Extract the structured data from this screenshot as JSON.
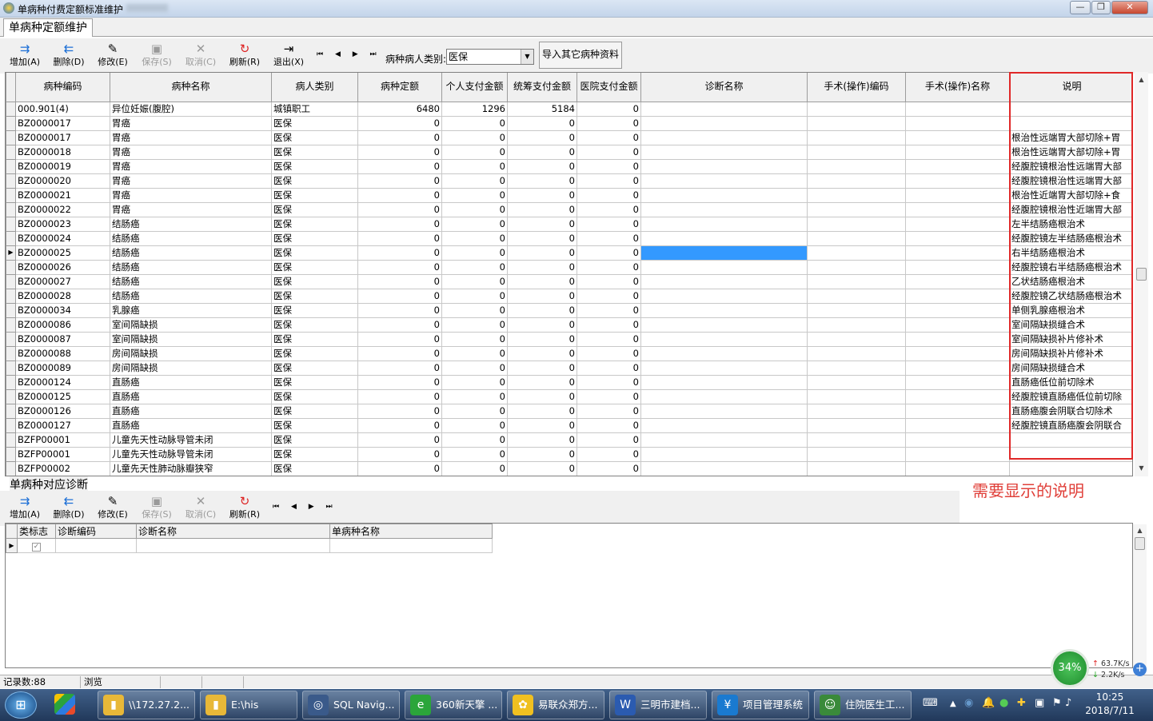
{
  "window": {
    "title": "单病种付费定额标准维护"
  },
  "tab": {
    "label": "单病种定额维护"
  },
  "toolbar": {
    "add": "增加(A)",
    "delete": "删除(D)",
    "edit": "修改(E)",
    "save": "保存(S)",
    "cancel": "取消(C)",
    "refresh": "刷新(R)",
    "exit": "退出(X)",
    "nav": "⏮ ◀ ▶ ⏭",
    "type_label": "病种病人类别:",
    "type_value": "医保",
    "import": "导入其它病种资料"
  },
  "grid": {
    "headers": [
      "病种编码",
      "病种名称",
      "病人类别",
      "病种定额",
      "个人支付金额",
      "统筹支付金额",
      "医院支付金额",
      "诊断名称",
      "手术(操作)编码",
      "手术(操作)名称",
      "说明"
    ],
    "rows": [
      [
        "000.901(4)",
        "异位妊娠(腹腔)",
        "城镇职工",
        "6480",
        "1296",
        "5184",
        "0",
        "",
        "",
        "",
        ""
      ],
      [
        "BZ0000017",
        "胃癌",
        "医保",
        "0",
        "0",
        "0",
        "0",
        "",
        "",
        "",
        ""
      ],
      [
        "BZ0000017",
        "胃癌",
        "医保",
        "0",
        "0",
        "0",
        "0",
        "",
        "",
        "",
        "根治性远端胃大部切除+胃"
      ],
      [
        "BZ0000018",
        "胃癌",
        "医保",
        "0",
        "0",
        "0",
        "0",
        "",
        "",
        "",
        "根治性远端胃大部切除+胃"
      ],
      [
        "BZ0000019",
        "胃癌",
        "医保",
        "0",
        "0",
        "0",
        "0",
        "",
        "",
        "",
        "经腹腔镜根治性远端胃大部"
      ],
      [
        "BZ0000020",
        "胃癌",
        "医保",
        "0",
        "0",
        "0",
        "0",
        "",
        "",
        "",
        "经腹腔镜根治性远端胃大部"
      ],
      [
        "BZ0000021",
        "胃癌",
        "医保",
        "0",
        "0",
        "0",
        "0",
        "",
        "",
        "",
        "根治性近端胃大部切除+食"
      ],
      [
        "BZ0000022",
        "胃癌",
        "医保",
        "0",
        "0",
        "0",
        "0",
        "",
        "",
        "",
        "经腹腔镜根治性近端胃大部"
      ],
      [
        "BZ0000023",
        "结肠癌",
        "医保",
        "0",
        "0",
        "0",
        "0",
        "",
        "",
        "",
        "左半结肠癌根治术"
      ],
      [
        "BZ0000024",
        "结肠癌",
        "医保",
        "0",
        "0",
        "0",
        "0",
        "",
        "",
        "",
        "经腹腔镜左半结肠癌根治术"
      ],
      [
        "BZ0000025",
        "结肠癌",
        "医保",
        "0",
        "0",
        "0",
        "0",
        "",
        "",
        "",
        "右半结肠癌根治术"
      ],
      [
        "BZ0000026",
        "结肠癌",
        "医保",
        "0",
        "0",
        "0",
        "0",
        "",
        "",
        "",
        "经腹腔镜右半结肠癌根治术"
      ],
      [
        "BZ0000027",
        "结肠癌",
        "医保",
        "0",
        "0",
        "0",
        "0",
        "",
        "",
        "",
        "乙状结肠癌根治术"
      ],
      [
        "BZ0000028",
        "结肠癌",
        "医保",
        "0",
        "0",
        "0",
        "0",
        "",
        "",
        "",
        "经腹腔镜乙状结肠癌根治术"
      ],
      [
        "BZ0000034",
        "乳腺癌",
        "医保",
        "0",
        "0",
        "0",
        "0",
        "",
        "",
        "",
        "单侧乳腺癌根治术"
      ],
      [
        "BZ0000086",
        "室间隔缺损",
        "医保",
        "0",
        "0",
        "0",
        "0",
        "",
        "",
        "",
        "室间隔缺损缝合术"
      ],
      [
        "BZ0000087",
        "室间隔缺损",
        "医保",
        "0",
        "0",
        "0",
        "0",
        "",
        "",
        "",
        "室间隔缺损补片修补术"
      ],
      [
        "BZ0000088",
        "房间隔缺损",
        "医保",
        "0",
        "0",
        "0",
        "0",
        "",
        "",
        "",
        "房间隔缺损补片修补术"
      ],
      [
        "BZ0000089",
        "房间隔缺损",
        "医保",
        "0",
        "0",
        "0",
        "0",
        "",
        "",
        "",
        "房间隔缺损缝合术"
      ],
      [
        "BZ0000124",
        "直肠癌",
        "医保",
        "0",
        "0",
        "0",
        "0",
        "",
        "",
        "",
        "直肠癌低位前切除术"
      ],
      [
        "BZ0000125",
        "直肠癌",
        "医保",
        "0",
        "0",
        "0",
        "0",
        "",
        "",
        "",
        "经腹腔镜直肠癌低位前切除"
      ],
      [
        "BZ0000126",
        "直肠癌",
        "医保",
        "0",
        "0",
        "0",
        "0",
        "",
        "",
        "",
        "直肠癌腹会阴联合切除术"
      ],
      [
        "BZ0000127",
        "直肠癌",
        "医保",
        "0",
        "0",
        "0",
        "0",
        "",
        "",
        "",
        "经腹腔镜直肠癌腹会阴联合"
      ],
      [
        "BZFP00001",
        "儿童先天性动脉导管未闭",
        "医保",
        "0",
        "0",
        "0",
        "0",
        "",
        "",
        "",
        ""
      ],
      [
        "BZFP00001",
        "儿童先天性动脉导管未闭",
        "医保",
        "0",
        "0",
        "0",
        "0",
        "",
        "",
        "",
        ""
      ],
      [
        "BZFP00002",
        "儿童先天性肺动脉瓣狭窄",
        "医保",
        "0",
        "0",
        "0",
        "0",
        "",
        "",
        "",
        ""
      ]
    ],
    "current_row": 10
  },
  "annotation": "需要显示的说明",
  "section2": {
    "title": "单病种对应诊断",
    "headers": [
      "类标志",
      "诊断编码",
      "诊断名称",
      "单病种名称"
    ]
  },
  "status": {
    "record_count": "记录数:88",
    "mode": "浏览"
  },
  "net": {
    "percent": "34%",
    "up": "63.7K/s",
    "down": "2.2K/s"
  },
  "taskbar": {
    "items": [
      "\\\\172.27.2...",
      "E:\\his",
      "SQL Navig...",
      "360新天擎 ...",
      "易联众郑方...",
      "三明市建档...",
      "项目管理系统",
      "住院医生工..."
    ]
  },
  "clock": {
    "time": "10:25",
    "date": "2018/7/11"
  },
  "colors": {
    "highlight": "#e02828",
    "selection": "#3399ff",
    "annotation": "#e0403a"
  }
}
